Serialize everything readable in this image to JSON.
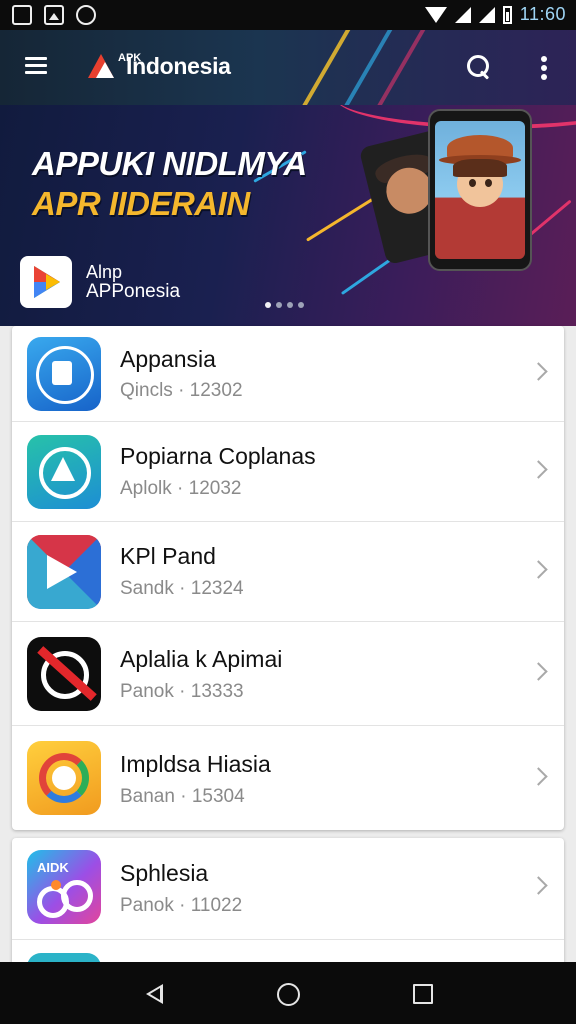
{
  "status_bar": {
    "time": "11:60",
    "icons": [
      "image-icon",
      "gallery-icon",
      "sync-icon",
      "wifi-icon",
      "signal-icon",
      "signal-icon",
      "battery-icon"
    ]
  },
  "app_bar": {
    "brand_small": "APK",
    "brand": "Indonesia",
    "menu_icon": "hamburger-menu-icon",
    "search_icon": "search-icon",
    "more_icon": "more-vertical-icon"
  },
  "banner": {
    "headline_line1": "APPUKI NIDLMYA",
    "headline_line2": "APR IIDERAIN",
    "app_label_line1": "Alnp",
    "app_label_line2": "APPonesia",
    "pager_count": 4,
    "pager_active": 0
  },
  "apps": [
    {
      "name": "Appansia",
      "subtitle": "Qincls · 12302",
      "icon": "app-icon-blue-square"
    },
    {
      "name": "Popiarna Coplanas",
      "subtitle": "Aplolk · 12032",
      "icon": "app-icon-teal-compass"
    },
    {
      "name": "KPl Pand",
      "subtitle": "Sandk · 12324",
      "icon": "app-icon-play-arrow"
    },
    {
      "name": "Aplalia k Apimai",
      "subtitle": "Panok · 13333",
      "icon": "app-icon-black-ring"
    },
    {
      "name": "Impldsa Hiasia",
      "subtitle": "Banan · 15304",
      "icon": "app-icon-yellow-ring"
    },
    {
      "name": "Sphlesia",
      "subtitle": "Panok · 11022",
      "icon": "app-icon-gradient-loop",
      "icon_text": "AIDK"
    }
  ],
  "nav_bar": {
    "back_icon": "back-triangle-icon",
    "home_icon": "home-circle-icon",
    "recent_icon": "recents-square-icon"
  },
  "colors": {
    "app_bar_gradient_start": "#152636",
    "banner_accent": "#f5b72d",
    "chevron": "#a9a9a9"
  }
}
